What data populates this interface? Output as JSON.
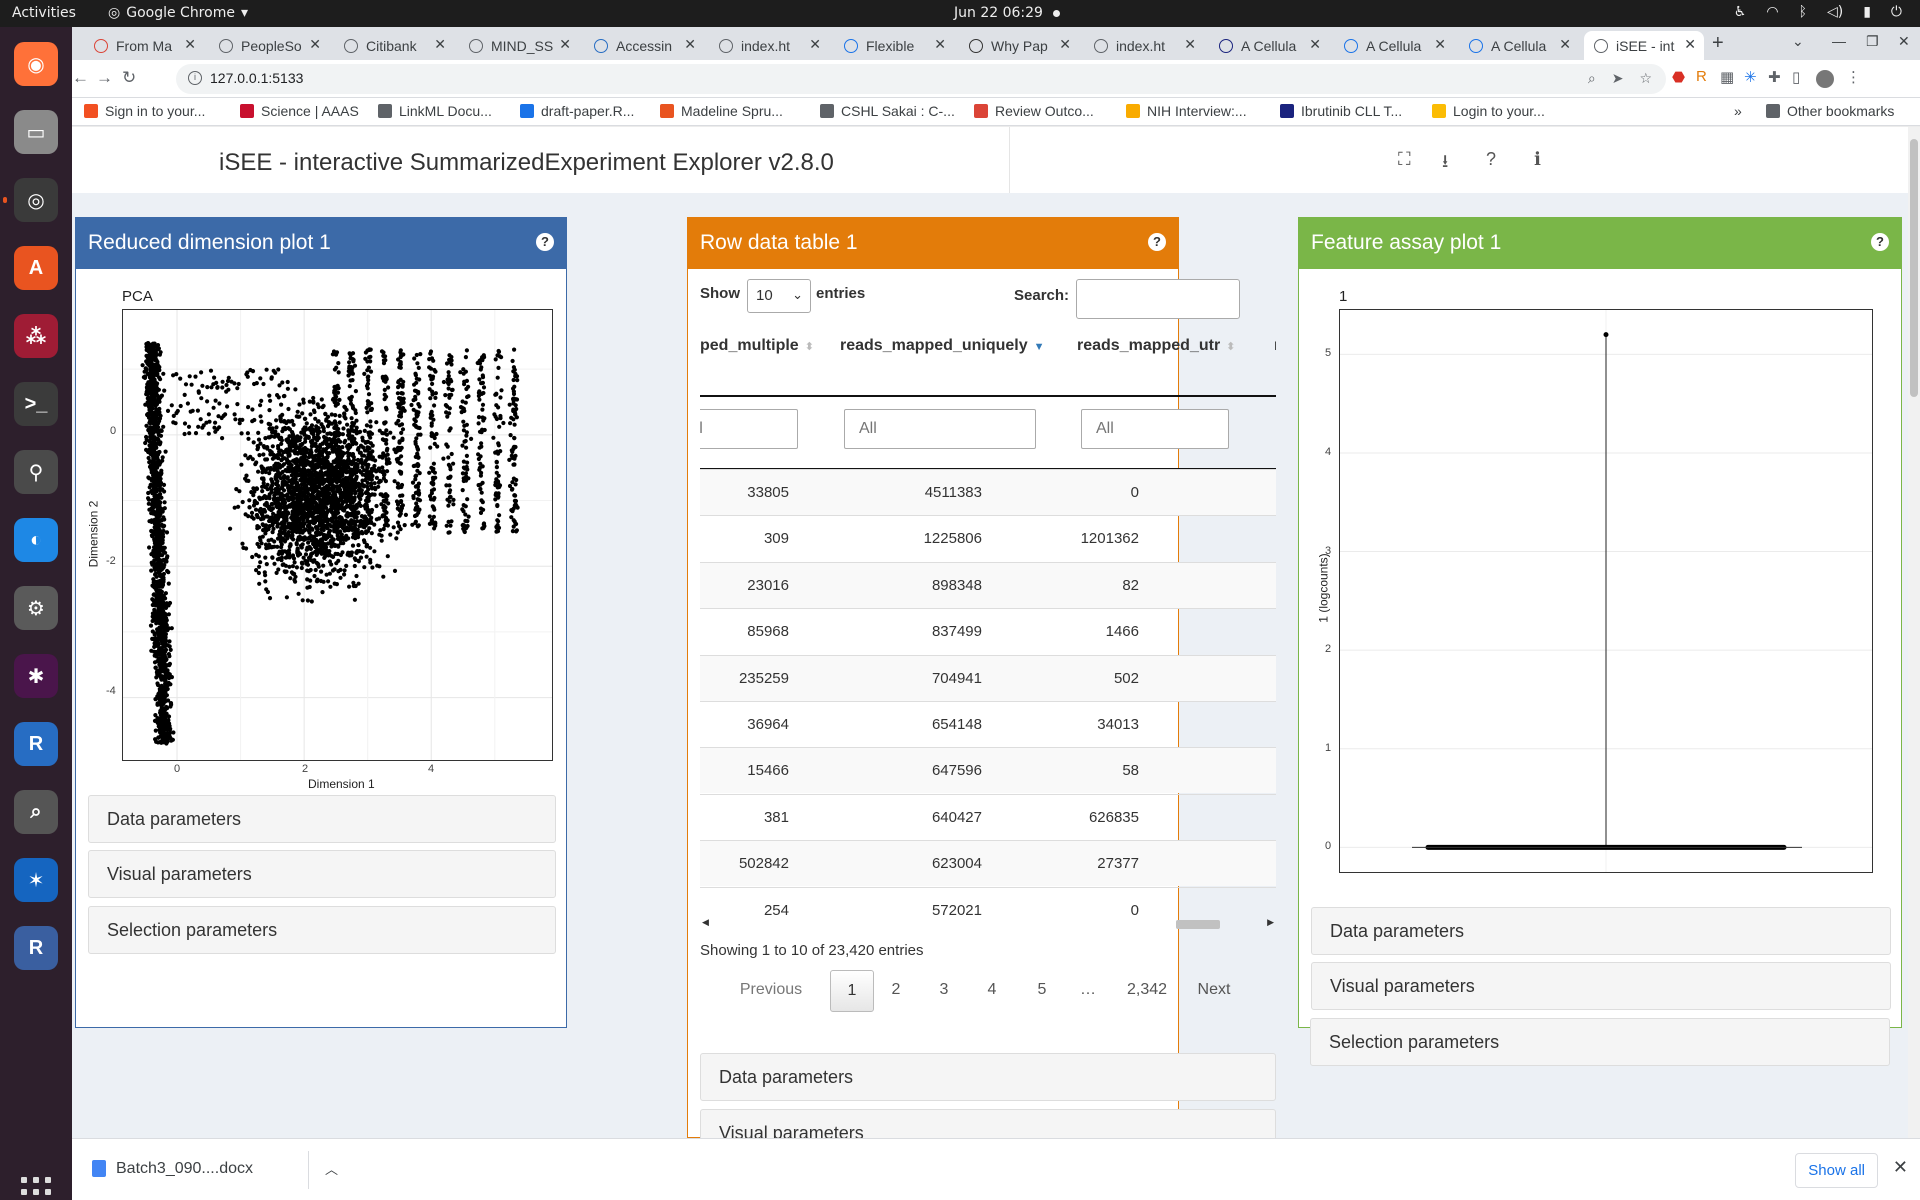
{
  "topbar": {
    "activities": "Activities",
    "app": "Google Chrome",
    "clock": "Jun 22  06:29"
  },
  "dock": [
    {
      "name": "firefox",
      "color": "#ff7139",
      "glyph": "◉"
    },
    {
      "name": "files",
      "color": "#8a8a8a",
      "glyph": "▭"
    },
    {
      "name": "chrome",
      "color": "#3a3a3a",
      "glyph": "◎"
    },
    {
      "name": "software",
      "color": "#e95420",
      "glyph": "A"
    },
    {
      "name": "mendeley",
      "color": "#9f1c35",
      "glyph": "⁂"
    },
    {
      "name": "terminal",
      "color": "#3b3b3b",
      "glyph": ">_"
    },
    {
      "name": "maps",
      "color": "#4a4a4a",
      "glyph": "⚲"
    },
    {
      "name": "crossover",
      "color": "#1e88e5",
      "glyph": "◐"
    },
    {
      "name": "settings",
      "color": "#5a5a5a",
      "glyph": "⚙"
    },
    {
      "name": "slack",
      "color": "#4a154b",
      "glyph": "✱"
    },
    {
      "name": "r-lang",
      "color": "#276dc3",
      "glyph": "R"
    },
    {
      "name": "magnifier",
      "color": "#555555",
      "glyph": "⌕"
    },
    {
      "name": "app-blue",
      "color": "#1565c0",
      "glyph": "✶"
    },
    {
      "name": "rstudio",
      "color": "#3a5fa0",
      "glyph": "R"
    }
  ],
  "tabs": [
    {
      "title": "From Ma",
      "fav": "#db4437"
    },
    {
      "title": "PeopleSo",
      "fav": "#5f6368"
    },
    {
      "title": "Citibank",
      "fav": "#5f6368"
    },
    {
      "title": "MIND_SS",
      "fav": "#5f6368"
    },
    {
      "title": "Accessin",
      "fav": "#276dc3"
    },
    {
      "title": "index.ht",
      "fav": "#5f6368"
    },
    {
      "title": "Flexible",
      "fav": "#1a73e8"
    },
    {
      "title": "Why Pap",
      "fav": "#333333"
    },
    {
      "title": "index.ht",
      "fav": "#5f6368"
    },
    {
      "title": "A Cellula",
      "fav": "#1a237e"
    },
    {
      "title": "A Cellula",
      "fav": "#1a73e8"
    },
    {
      "title": "A Cellula",
      "fav": "#1a73e8"
    },
    {
      "title": "iSEE - int",
      "fav": "#5f6368"
    }
  ],
  "omnibox": {
    "url": "127.0.0.1:5133"
  },
  "bookmarks": [
    {
      "label": "Sign in to your...",
      "color": "#f25022"
    },
    {
      "label": "Science | AAAS",
      "color": "#c8102e"
    },
    {
      "label": "LinkML Docu...",
      "color": "#5f6368"
    },
    {
      "label": "draft-paper.R...",
      "color": "#1a73e8"
    },
    {
      "label": "Madeline Spru...",
      "color": "#e95420"
    },
    {
      "label": "CSHL Sakai : C-...",
      "color": "#5f6368"
    },
    {
      "label": "Review Outco...",
      "color": "#db4437"
    },
    {
      "label": "NIH Interview:...",
      "color": "#f9ab00"
    },
    {
      "label": "Ibrutinib CLL T...",
      "color": "#1a237e"
    },
    {
      "label": "Login to your...",
      "color": "#fbbc04"
    }
  ],
  "bookmarks_more": "»",
  "other_bookmarks": "Other bookmarks",
  "app": {
    "title": "iSEE - interactive SummarizedExperiment Explorer v2.8.0"
  },
  "panels": {
    "reduced": {
      "title": "Reduced dimension plot 1",
      "color": "#3c6aa8",
      "plot_title": "PCA",
      "xlabel": "Dimension 1",
      "ylabel": "Dimension 2",
      "xticks": [
        "0",
        "2",
        "4"
      ],
      "yticks": [
        "0",
        "-2",
        "-4"
      ],
      "accordions": [
        "Data parameters",
        "Visual parameters",
        "Selection parameters"
      ]
    },
    "table": {
      "title": "Row data table 1",
      "color": "#e37c0a",
      "show": "Show",
      "entries_value": "10",
      "entries": "entries",
      "search_label": "Search:",
      "columns": [
        "ped_multiple",
        "reads_mapped_uniquely",
        "reads_mapped_utr",
        "r"
      ],
      "filter_placeholder": "All",
      "rows": [
        [
          "33805",
          "4511383",
          "0"
        ],
        [
          "309",
          "1225806",
          "1201362"
        ],
        [
          "23016",
          "898348",
          "82"
        ],
        [
          "85968",
          "837499",
          "1466"
        ],
        [
          "235259",
          "704941",
          "502"
        ],
        [
          "36964",
          "654148",
          "34013"
        ],
        [
          "15466",
          "647596",
          "58"
        ],
        [
          "381",
          "640427",
          "626835"
        ],
        [
          "502842",
          "623004",
          "27377"
        ],
        [
          "254",
          "572021",
          "0"
        ]
      ],
      "info": "Showing 1 to 10 of 23,420 entries",
      "pager": [
        "Previous",
        "1",
        "2",
        "3",
        "4",
        "5",
        "…",
        "2,342",
        "Next"
      ],
      "accordions": [
        "Data parameters",
        "Visual parameters"
      ]
    },
    "feature": {
      "title": "Feature assay plot 1",
      "color": "#7ab648",
      "plot_title": "1",
      "ylabel": "1 (logcounts)",
      "yticks": [
        "5",
        "4",
        "3",
        "2",
        "1",
        "0"
      ],
      "accordions": [
        "Data parameters",
        "Visual parameters",
        "Selection parameters"
      ]
    }
  },
  "chart_data": [
    {
      "type": "scatter",
      "title": "PCA",
      "xlabel": "Dimension 1",
      "ylabel": "Dimension 2",
      "xlim": [
        -0.85,
        5.9
      ],
      "ylim": [
        -4.95,
        1.9
      ],
      "x_ticks": [
        0,
        2,
        4
      ],
      "y_ticks": [
        0,
        -2,
        -4
      ],
      "grid": true,
      "clusters": [
        {
          "label_region": "left band",
          "x_range": [
            -0.55,
            -0.05
          ],
          "y_range": [
            -4.7,
            1.4
          ],
          "approx_points": 1300
        },
        {
          "label_region": "main cloud",
          "x_center": 2.2,
          "y_center": -0.9,
          "x_spread": 0.9,
          "y_spread": 1.1,
          "approx_points": 2200
        },
        {
          "label_region": "upper right stripes",
          "x_range": [
            2.5,
            5.3
          ],
          "y_range": [
            -1.5,
            1.3
          ],
          "approx_points": 900
        }
      ]
    },
    {
      "type": "violin",
      "title": "1",
      "ylabel": "1 (logcounts)",
      "ylim": [
        -0.25,
        5.45
      ],
      "y_ticks": [
        0,
        1,
        2,
        3,
        4,
        5
      ],
      "grid": true,
      "max_value": 5.2,
      "bulk_value": 0
    }
  ],
  "shelf": {
    "file": "Batch3_090....docx",
    "show_all": "Show all"
  }
}
